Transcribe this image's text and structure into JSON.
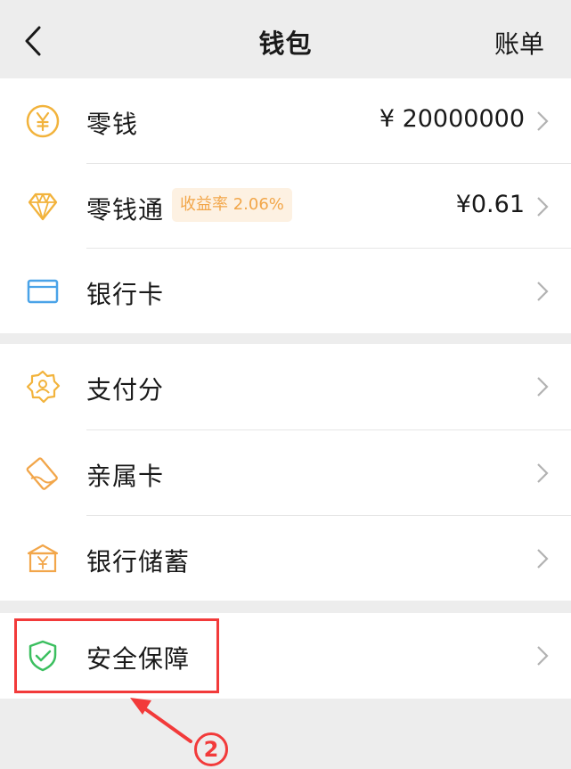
{
  "header": {
    "title": "钱包",
    "bill_label": "账单"
  },
  "section1": [
    {
      "label": "零钱",
      "value": "¥ 20000000",
      "icon": "coin-yuan-icon"
    },
    {
      "label": "零钱通",
      "badge": "收益率 2.06%",
      "value": "¥0.61",
      "icon": "diamond-icon"
    },
    {
      "label": "银行卡",
      "icon": "bank-card-icon"
    }
  ],
  "section2": [
    {
      "label": "支付分",
      "icon": "payment-score-icon"
    },
    {
      "label": "亲属卡",
      "icon": "family-card-icon"
    },
    {
      "label": "银行储蓄",
      "icon": "bank-savings-icon"
    }
  ],
  "section3": [
    {
      "label": "安全保障",
      "icon": "shield-check-icon"
    }
  ],
  "annotation": {
    "step_number": "2"
  },
  "colors": {
    "accent_orange": "#f2b33c",
    "card_blue": "#4aa3e8",
    "shield_green": "#3bbf5f",
    "highlight_red": "#f23a3a",
    "badge_text": "#f2a649"
  }
}
